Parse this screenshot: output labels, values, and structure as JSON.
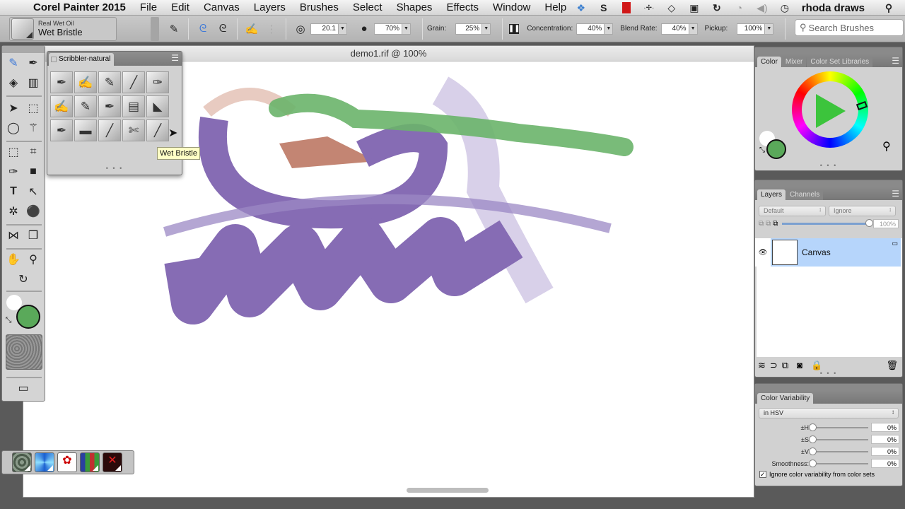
{
  "menubar": {
    "apple": "",
    "app_name": "Corel Painter 2015",
    "menus": [
      "File",
      "Edit",
      "Canvas",
      "Layers",
      "Brushes",
      "Select",
      "Shapes",
      "Effects",
      "Window",
      "Help"
    ],
    "status_icons": [
      "dropbox-icon",
      "skype-icon",
      "film-icon",
      "bluetooth-icon",
      "wifi-icon",
      "display-icon",
      "sync-icon",
      "time-machine-icon",
      "volume-icon",
      "clock-icon"
    ],
    "user": "rhoda draws",
    "spotlight": "⌕"
  },
  "propbar": {
    "brush_category": "Real Wet Oil",
    "brush_variant": "Wet Bristle",
    "size_value": "20.1",
    "opacity_value": "70%",
    "grain_label": "Grain:",
    "grain_value": "25%",
    "concentration_label": "Concentration:",
    "concentration_value": "40%",
    "blend_rate_label": "Blend Rate:",
    "blend_rate_value": "40%",
    "pickup_label": "Pickup:",
    "pickup_value": "100%",
    "search_placeholder": "Search Brushes"
  },
  "document": {
    "title": "demo1.rif @ 100%"
  },
  "brush_library": {
    "tab": "Scribbler-natural",
    "tooltip": "Wet Bristle",
    "dots": "• • •"
  },
  "color_panel": {
    "tabs": [
      "Color",
      "Mixer",
      "Color Set Libraries"
    ],
    "main_color": "#5aa95a",
    "secondary_color": "#ffffff",
    "dots": "• • •"
  },
  "layers_panel": {
    "tabs": [
      "Layers",
      "Channels"
    ],
    "composite_method": "Default",
    "preserve": "Ignore",
    "opacity": "100%",
    "layers": [
      {
        "name": "Canvas",
        "selected": true,
        "visible": true
      }
    ],
    "dots": "• • •"
  },
  "color_variability": {
    "title": "Color Variability",
    "mode": "in HSV",
    "rows": [
      {
        "label": "±H",
        "value": "0%"
      },
      {
        "label": "±S",
        "value": "0%"
      },
      {
        "label": "±V",
        "value": "0%"
      },
      {
        "label": "Smoothness:",
        "value": "0%"
      }
    ],
    "checkbox_label": "Ignore color variability from color sets",
    "checkbox_checked": true
  },
  "colors": {
    "paint_purple": "#866cb4",
    "paint_green": "#6ab46a",
    "paint_brown": "#b8705a",
    "selection_blue": "#b6d5fb"
  }
}
